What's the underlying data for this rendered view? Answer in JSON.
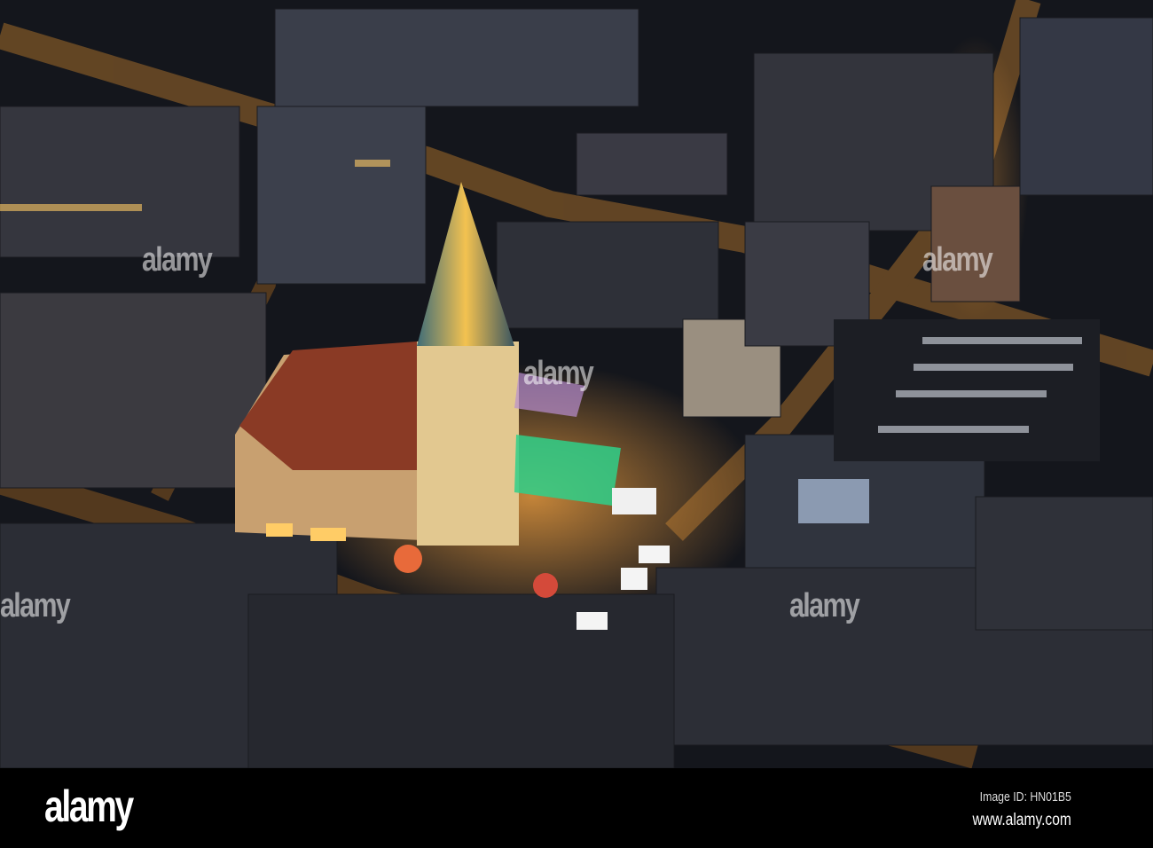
{
  "photo": {
    "subject": "night aerial city center with church and christmas market",
    "watermark": "alamy"
  },
  "footer": {
    "logo": "alamy",
    "image_id": "Image ID: HN01B5",
    "url": "www.alamy.com"
  },
  "colors": {
    "street_light": "#e8952a",
    "rink": "#2fd08a",
    "roof": "#2a2c34"
  }
}
